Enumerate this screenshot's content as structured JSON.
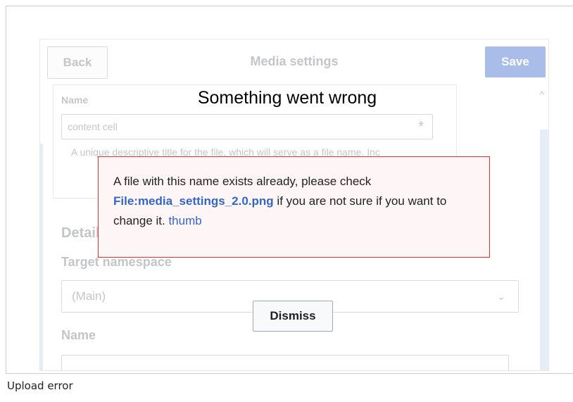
{
  "background_dialog": {
    "back_label": "Back",
    "title": "Media settings",
    "save_label": "Save",
    "name_label": "Name",
    "name_value": "content cell",
    "required_marker": "*",
    "hint_text": "A unique descriptive title for the file, which will serve as a file name. Inc",
    "details_heading": "Details",
    "target_namespace_label": "Target namespace",
    "namespace_selected": "(Main)",
    "name2_label": "Name"
  },
  "error_dialog": {
    "title": "Something went wrong",
    "message_before": "A file with this name exists already, please check ",
    "file_link": "File:media_settings_2.0.png",
    "message_after": " if you are not sure if you want to change it. ",
    "thumb_link": "thumb",
    "dismiss_label": "Dismiss"
  },
  "caption": "Upload error",
  "colors": {
    "accent": "#3366cc",
    "error_border": "#dd3333",
    "error_background": "#fef6f6"
  }
}
